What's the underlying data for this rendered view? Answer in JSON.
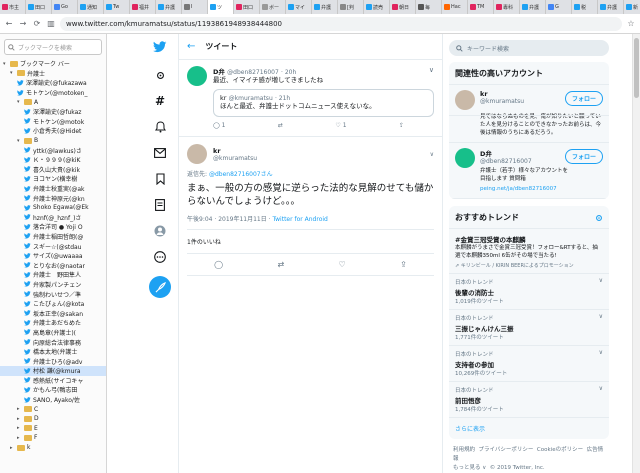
{
  "tabs": [
    "市主",
    "田口",
    "Go",
    "通知",
    "Tw",
    "福井",
    "弁護",
    "I",
    "ツ",
    "田口",
    "ボー",
    "マイ",
    "弁護",
    "[判",
    "読売",
    "朝日",
    "毎",
    "Hac",
    "TM",
    "專科",
    "弁護",
    "G",
    "税",
    "弁護",
    "新"
  ],
  "address": {
    "url": "www.twitter.com/kmuramatsu/status/1193861948938444800"
  },
  "bookmarks": {
    "search_placeholder": "ブックマークを検索",
    "items": [
      {
        "label": "ブックマーク バー",
        "level": 0,
        "type": "folder",
        "open": true
      },
      {
        "label": "弁護士",
        "level": 1,
        "type": "folder",
        "open": true
      },
      {
        "label": "深澤諭史(@fukazawa",
        "level": 2,
        "type": "bird"
      },
      {
        "label": "モトケン(@motoken_",
        "level": 2,
        "type": "bird"
      },
      {
        "label": "A",
        "level": 2,
        "type": "folder",
        "open": true
      },
      {
        "label": "深澤諭史(@fukaz",
        "level": 3,
        "type": "bird"
      },
      {
        "label": "モトケン(@motok",
        "level": 3,
        "type": "bird"
      },
      {
        "label": "小倉秀夫(@Hidet",
        "level": 3,
        "type": "bird"
      },
      {
        "label": "B",
        "level": 2,
        "type": "folder",
        "open": true
      },
      {
        "label": "yttk(@lawkus)さ",
        "level": 3,
        "type": "bird"
      },
      {
        "label": "Ｋ・９９９(@kiK",
        "level": 3,
        "type": "bird"
      },
      {
        "label": "喜久山大貴(@kik",
        "level": 3,
        "type": "bird"
      },
      {
        "label": "ヨコヤン(横幸樹",
        "level": 3,
        "type": "bird"
      },
      {
        "label": "弁護士秋重実(@ak",
        "level": 3,
        "type": "bird"
      },
      {
        "label": "弁護士神原元(@kn",
        "level": 3,
        "type": "bird"
      },
      {
        "label": "Shoko Egawa(@Ek",
        "level": 3,
        "type": "bird"
      },
      {
        "label": "hznf(@_hznf_)さ",
        "level": 3,
        "type": "bird"
      },
      {
        "label": "落合洋司 ● Yoji O",
        "level": 3,
        "type": "bird"
      },
      {
        "label": "弁護士稲田哲朗(@",
        "level": 3,
        "type": "bird"
      },
      {
        "label": "スギー☆(@stdau",
        "level": 3,
        "type": "bird"
      },
      {
        "label": "サイズ(@uwaaaa",
        "level": 3,
        "type": "bird"
      },
      {
        "label": "とりなお(@naotar",
        "level": 3,
        "type": "bird"
      },
      {
        "label": "弁護士　野田隼人",
        "level": 3,
        "type": "bird"
      },
      {
        "label": "弁家製パンチェン",
        "level": 3,
        "type": "bird"
      },
      {
        "label": "強制わいせつ／準",
        "level": 3,
        "type": "bird"
      },
      {
        "label": "こたぴょん(@kota",
        "level": 3,
        "type": "bird"
      },
      {
        "label": "坂本正幸(@sakan",
        "level": 3,
        "type": "bird"
      },
      {
        "label": "弁護士あだちめた",
        "level": 3,
        "type": "bird"
      },
      {
        "label": "高島章(弁護士)(",
        "level": 3,
        "type": "bird"
      },
      {
        "label": "向原総合法律事務",
        "level": 3,
        "type": "bird"
      },
      {
        "label": "橋本太地(弁護士",
        "level": 3,
        "type": "bird"
      },
      {
        "label": "弁護士ひろ(@adv",
        "level": 3,
        "type": "bird"
      },
      {
        "label": "村松 謙(@kmura",
        "level": 3,
        "type": "bird",
        "selected": true
      },
      {
        "label": "感熱紙(サイコキャ",
        "level": 3,
        "type": "bird"
      },
      {
        "label": "かもん弓(鴨志田",
        "level": 3,
        "type": "bird"
      },
      {
        "label": "SANO, Ayako/佐",
        "level": 3,
        "type": "bird"
      },
      {
        "label": "C",
        "level": 2,
        "type": "folder",
        "open": false
      },
      {
        "label": "D",
        "level": 2,
        "type": "folder",
        "open": false
      },
      {
        "label": "E",
        "level": 2,
        "type": "folder",
        "open": false
      },
      {
        "label": "F",
        "level": 2,
        "type": "folder",
        "open": false
      },
      {
        "label": "k",
        "level": 1,
        "type": "folder",
        "open": false
      }
    ]
  },
  "center": {
    "header": "ツイート",
    "tweet1": {
      "name": "D弁",
      "handle": "@dben82716007",
      "time": "· 20h",
      "text": "最近、イマイチ感が増してきましたね",
      "quote": {
        "name": "kr",
        "handle": "@kmuramatsu",
        "time": "· 21h",
        "text": "ほんと最近、弁護士ドットコムニュース使えないな。"
      },
      "reply_count": "1",
      "like_count": "1"
    },
    "main": {
      "name": "kr",
      "handle": "@kmuramatsu",
      "reply_label": "返信先:",
      "reply_to": "@dben82716007さん",
      "text": "まぁ、一般の方の感覚に逆らった法的な見解のせても儲からないんでしょうけど。。。",
      "time": "午後9:04 · 2019年11月11日 · ",
      "source": "Twitter for Android",
      "likes": "1件のいいね"
    }
  },
  "right": {
    "search_placeholder": "キーワード検索",
    "related_title": "関連性の高いアカウント",
    "follow_label": "フォロー",
    "accounts": [
      {
        "name": "kr",
        "handle": "@kmuramatsu",
        "bio": "見ではならぬものを見、俺が知りたいと願っていた人を見分けることのできなかったお前らは、今後は情報のうちにあるだろう。",
        "link": ""
      },
      {
        "name": "D弁",
        "handle": "@dben82716007",
        "bio": "弁護士（若手）様々なアカウントを目指します 質問箱",
        "link": "peing.net/ja/dben82716007"
      }
    ],
    "trends_title": "おすすめトレンド",
    "trends": [
      {
        "context": "",
        "name": "#金賞三冠受賞の本麒麟",
        "desc": "本麒麟がうまさで金賞三冠受賞！フォロー&RTすると、抽選で本麒麟350ml 6缶がその場で当たる!",
        "promo": "キリンビール / KIRIN BEERによるプロモーション"
      },
      {
        "context": "日本のトレンド",
        "name": "後輩の消防士",
        "count": "1,019件のツイート"
      },
      {
        "context": "日本のトレンド",
        "name": "三振じゃんけん三振",
        "count": "1,771件のツイート"
      },
      {
        "context": "日本のトレンド",
        "name": "支持者の参加",
        "count": "10,269件のツイート"
      },
      {
        "context": "日本のトレンド",
        "name": "前田悟彦",
        "count": "1,784件のツイート"
      }
    ],
    "more": "さらに表示",
    "footer": [
      "利用規約",
      "プライバシーポリシー",
      "Cookieのポリシー",
      "広告情報",
      "もっと見る ∨",
      "© 2019 Twitter, Inc."
    ]
  },
  "colors": {
    "accent": "#1da1f2",
    "folder": "#e6b84d"
  }
}
